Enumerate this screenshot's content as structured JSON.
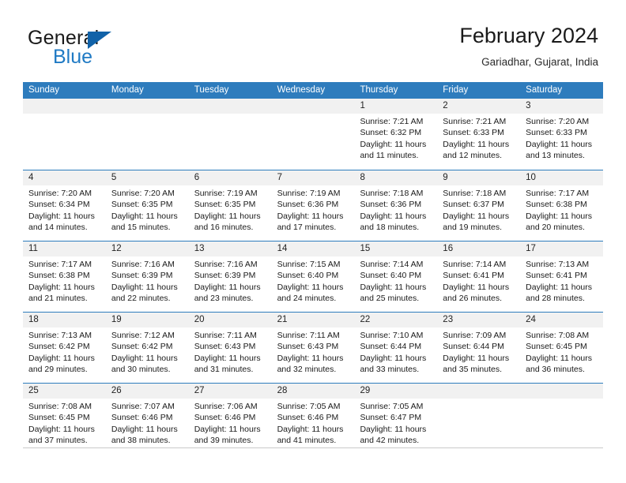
{
  "brand": {
    "name_primary": "General",
    "name_secondary": "Blue",
    "flag_icon": "blue-triangle-icon",
    "accent_color": "#1f7ac4"
  },
  "header": {
    "title": "February 2024",
    "location": "Gariadhar, Gujarat, India"
  },
  "calendar": {
    "header_color": "#2e7cbd",
    "day_number_band_color": "#f1f1f1",
    "weekdays": [
      "Sunday",
      "Monday",
      "Tuesday",
      "Wednesday",
      "Thursday",
      "Friday",
      "Saturday"
    ],
    "weeks": [
      [
        {
          "day": "",
          "empty": true
        },
        {
          "day": "",
          "empty": true
        },
        {
          "day": "",
          "empty": true
        },
        {
          "day": "",
          "empty": true
        },
        {
          "day": "1",
          "sunrise": "Sunrise: 7:21 AM",
          "sunset": "Sunset: 6:32 PM",
          "daylight": "Daylight: 11 hours and 11 minutes."
        },
        {
          "day": "2",
          "sunrise": "Sunrise: 7:21 AM",
          "sunset": "Sunset: 6:33 PM",
          "daylight": "Daylight: 11 hours and 12 minutes."
        },
        {
          "day": "3",
          "sunrise": "Sunrise: 7:20 AM",
          "sunset": "Sunset: 6:33 PM",
          "daylight": "Daylight: 11 hours and 13 minutes."
        }
      ],
      [
        {
          "day": "4",
          "sunrise": "Sunrise: 7:20 AM",
          "sunset": "Sunset: 6:34 PM",
          "daylight": "Daylight: 11 hours and 14 minutes."
        },
        {
          "day": "5",
          "sunrise": "Sunrise: 7:20 AM",
          "sunset": "Sunset: 6:35 PM",
          "daylight": "Daylight: 11 hours and 15 minutes."
        },
        {
          "day": "6",
          "sunrise": "Sunrise: 7:19 AM",
          "sunset": "Sunset: 6:35 PM",
          "daylight": "Daylight: 11 hours and 16 minutes."
        },
        {
          "day": "7",
          "sunrise": "Sunrise: 7:19 AM",
          "sunset": "Sunset: 6:36 PM",
          "daylight": "Daylight: 11 hours and 17 minutes."
        },
        {
          "day": "8",
          "sunrise": "Sunrise: 7:18 AM",
          "sunset": "Sunset: 6:36 PM",
          "daylight": "Daylight: 11 hours and 18 minutes."
        },
        {
          "day": "9",
          "sunrise": "Sunrise: 7:18 AM",
          "sunset": "Sunset: 6:37 PM",
          "daylight": "Daylight: 11 hours and 19 minutes."
        },
        {
          "day": "10",
          "sunrise": "Sunrise: 7:17 AM",
          "sunset": "Sunset: 6:38 PM",
          "daylight": "Daylight: 11 hours and 20 minutes."
        }
      ],
      [
        {
          "day": "11",
          "sunrise": "Sunrise: 7:17 AM",
          "sunset": "Sunset: 6:38 PM",
          "daylight": "Daylight: 11 hours and 21 minutes."
        },
        {
          "day": "12",
          "sunrise": "Sunrise: 7:16 AM",
          "sunset": "Sunset: 6:39 PM",
          "daylight": "Daylight: 11 hours and 22 minutes."
        },
        {
          "day": "13",
          "sunrise": "Sunrise: 7:16 AM",
          "sunset": "Sunset: 6:39 PM",
          "daylight": "Daylight: 11 hours and 23 minutes."
        },
        {
          "day": "14",
          "sunrise": "Sunrise: 7:15 AM",
          "sunset": "Sunset: 6:40 PM",
          "daylight": "Daylight: 11 hours and 24 minutes."
        },
        {
          "day": "15",
          "sunrise": "Sunrise: 7:14 AM",
          "sunset": "Sunset: 6:40 PM",
          "daylight": "Daylight: 11 hours and 25 minutes."
        },
        {
          "day": "16",
          "sunrise": "Sunrise: 7:14 AM",
          "sunset": "Sunset: 6:41 PM",
          "daylight": "Daylight: 11 hours and 26 minutes."
        },
        {
          "day": "17",
          "sunrise": "Sunrise: 7:13 AM",
          "sunset": "Sunset: 6:41 PM",
          "daylight": "Daylight: 11 hours and 28 minutes."
        }
      ],
      [
        {
          "day": "18",
          "sunrise": "Sunrise: 7:13 AM",
          "sunset": "Sunset: 6:42 PM",
          "daylight": "Daylight: 11 hours and 29 minutes."
        },
        {
          "day": "19",
          "sunrise": "Sunrise: 7:12 AM",
          "sunset": "Sunset: 6:42 PM",
          "daylight": "Daylight: 11 hours and 30 minutes."
        },
        {
          "day": "20",
          "sunrise": "Sunrise: 7:11 AM",
          "sunset": "Sunset: 6:43 PM",
          "daylight": "Daylight: 11 hours and 31 minutes."
        },
        {
          "day": "21",
          "sunrise": "Sunrise: 7:11 AM",
          "sunset": "Sunset: 6:43 PM",
          "daylight": "Daylight: 11 hours and 32 minutes."
        },
        {
          "day": "22",
          "sunrise": "Sunrise: 7:10 AM",
          "sunset": "Sunset: 6:44 PM",
          "daylight": "Daylight: 11 hours and 33 minutes."
        },
        {
          "day": "23",
          "sunrise": "Sunrise: 7:09 AM",
          "sunset": "Sunset: 6:44 PM",
          "daylight": "Daylight: 11 hours and 35 minutes."
        },
        {
          "day": "24",
          "sunrise": "Sunrise: 7:08 AM",
          "sunset": "Sunset: 6:45 PM",
          "daylight": "Daylight: 11 hours and 36 minutes."
        }
      ],
      [
        {
          "day": "25",
          "sunrise": "Sunrise: 7:08 AM",
          "sunset": "Sunset: 6:45 PM",
          "daylight": "Daylight: 11 hours and 37 minutes."
        },
        {
          "day": "26",
          "sunrise": "Sunrise: 7:07 AM",
          "sunset": "Sunset: 6:46 PM",
          "daylight": "Daylight: 11 hours and 38 minutes."
        },
        {
          "day": "27",
          "sunrise": "Sunrise: 7:06 AM",
          "sunset": "Sunset: 6:46 PM",
          "daylight": "Daylight: 11 hours and 39 minutes."
        },
        {
          "day": "28",
          "sunrise": "Sunrise: 7:05 AM",
          "sunset": "Sunset: 6:46 PM",
          "daylight": "Daylight: 11 hours and 41 minutes."
        },
        {
          "day": "29",
          "sunrise": "Sunrise: 7:05 AM",
          "sunset": "Sunset: 6:47 PM",
          "daylight": "Daylight: 11 hours and 42 minutes."
        },
        {
          "day": "",
          "empty": true
        },
        {
          "day": "",
          "empty": true
        }
      ]
    ]
  }
}
